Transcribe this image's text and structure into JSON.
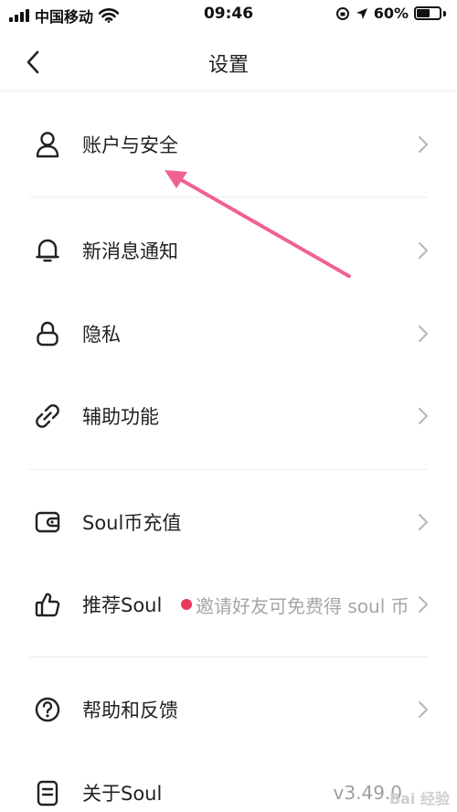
{
  "status_bar": {
    "carrier": "中国移动",
    "time": "09:46",
    "battery_percent": "60%",
    "battery_level": 0.6
  },
  "nav": {
    "title": "设置"
  },
  "menu": [
    {
      "label": "账户与安全",
      "icon": "user-icon"
    },
    {
      "label": "新消息通知",
      "icon": "bell-icon"
    },
    {
      "label": "隐私",
      "icon": "lock-icon"
    },
    {
      "label": "辅助功能",
      "icon": "link-icon"
    },
    {
      "label": "Soul币充值",
      "icon": "wallet-icon"
    },
    {
      "label": "推荐Soul",
      "icon": "thumbs-up-icon",
      "promo": "邀请好友可免费得 soul 币"
    },
    {
      "label": "帮助和反馈",
      "icon": "help-icon"
    },
    {
      "label": "关于Soul",
      "icon": "document-icon",
      "version": "v3.49.0"
    }
  ],
  "annotation_color": "#f06292",
  "accent_red": "#e8395a",
  "watermark": "Bai 经验"
}
